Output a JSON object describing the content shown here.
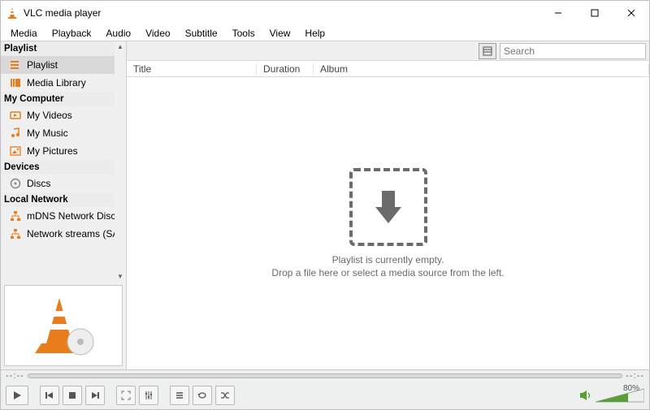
{
  "window": {
    "title": "VLC media player"
  },
  "menu": {
    "items": [
      "Media",
      "Playback",
      "Audio",
      "Video",
      "Subtitle",
      "Tools",
      "View",
      "Help"
    ]
  },
  "sidebar": {
    "sections": [
      {
        "header": "Playlist",
        "items": [
          {
            "label": "Playlist",
            "icon": "list-icon",
            "selected": true
          },
          {
            "label": "Media Library",
            "icon": "library-icon"
          }
        ]
      },
      {
        "header": "My Computer",
        "items": [
          {
            "label": "My Videos",
            "icon": "video-icon"
          },
          {
            "label": "My Music",
            "icon": "music-icon"
          },
          {
            "label": "My Pictures",
            "icon": "pictures-icon"
          }
        ]
      },
      {
        "header": "Devices",
        "items": [
          {
            "label": "Discs",
            "icon": "disc-icon"
          }
        ]
      },
      {
        "header": "Local Network",
        "items": [
          {
            "label": "mDNS Network Disco...",
            "icon": "network-icon"
          },
          {
            "label": "Network streams (SAP)",
            "icon": "network-icon"
          }
        ]
      }
    ]
  },
  "main": {
    "search_placeholder": "Search",
    "columns": [
      "Title",
      "Duration",
      "Album"
    ],
    "empty_line1": "Playlist is currently empty.",
    "empty_line2": "Drop a file here or select a media source from the left."
  },
  "seek": {
    "current": "--:--",
    "total": "--:--"
  },
  "volume": {
    "percent": "80%"
  }
}
